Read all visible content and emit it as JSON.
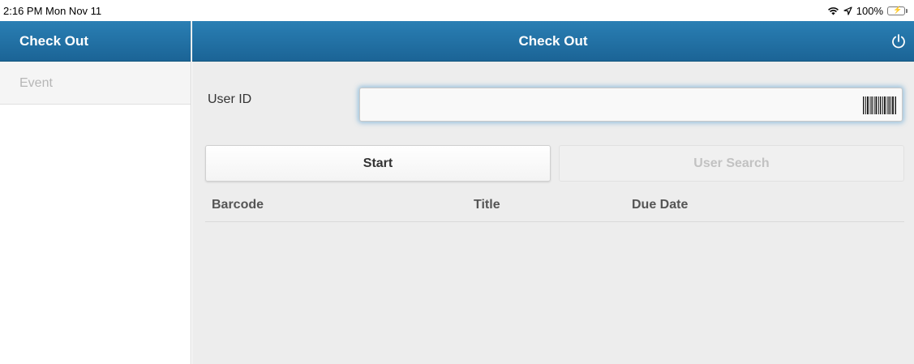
{
  "status_bar": {
    "time_date": "2:16 PM   Mon Nov 11",
    "battery": "100%",
    "icons": [
      "wifi-icon",
      "location-icon",
      "battery-icon"
    ]
  },
  "sidebar": {
    "header": "Check Out",
    "items": [
      {
        "label": "Event"
      }
    ]
  },
  "topbar": {
    "title": "Check Out",
    "power_icon": "power-icon"
  },
  "form": {
    "user_id_label": "User ID",
    "user_id_value": "",
    "user_id_placeholder": ""
  },
  "buttons": {
    "start": "Start",
    "user_search": "User Search"
  },
  "table": {
    "columns": [
      "Barcode",
      "Title",
      "Due Date"
    ],
    "rows": []
  },
  "colors": {
    "header_blue": "#1f6fa3",
    "background": "#ededed"
  }
}
